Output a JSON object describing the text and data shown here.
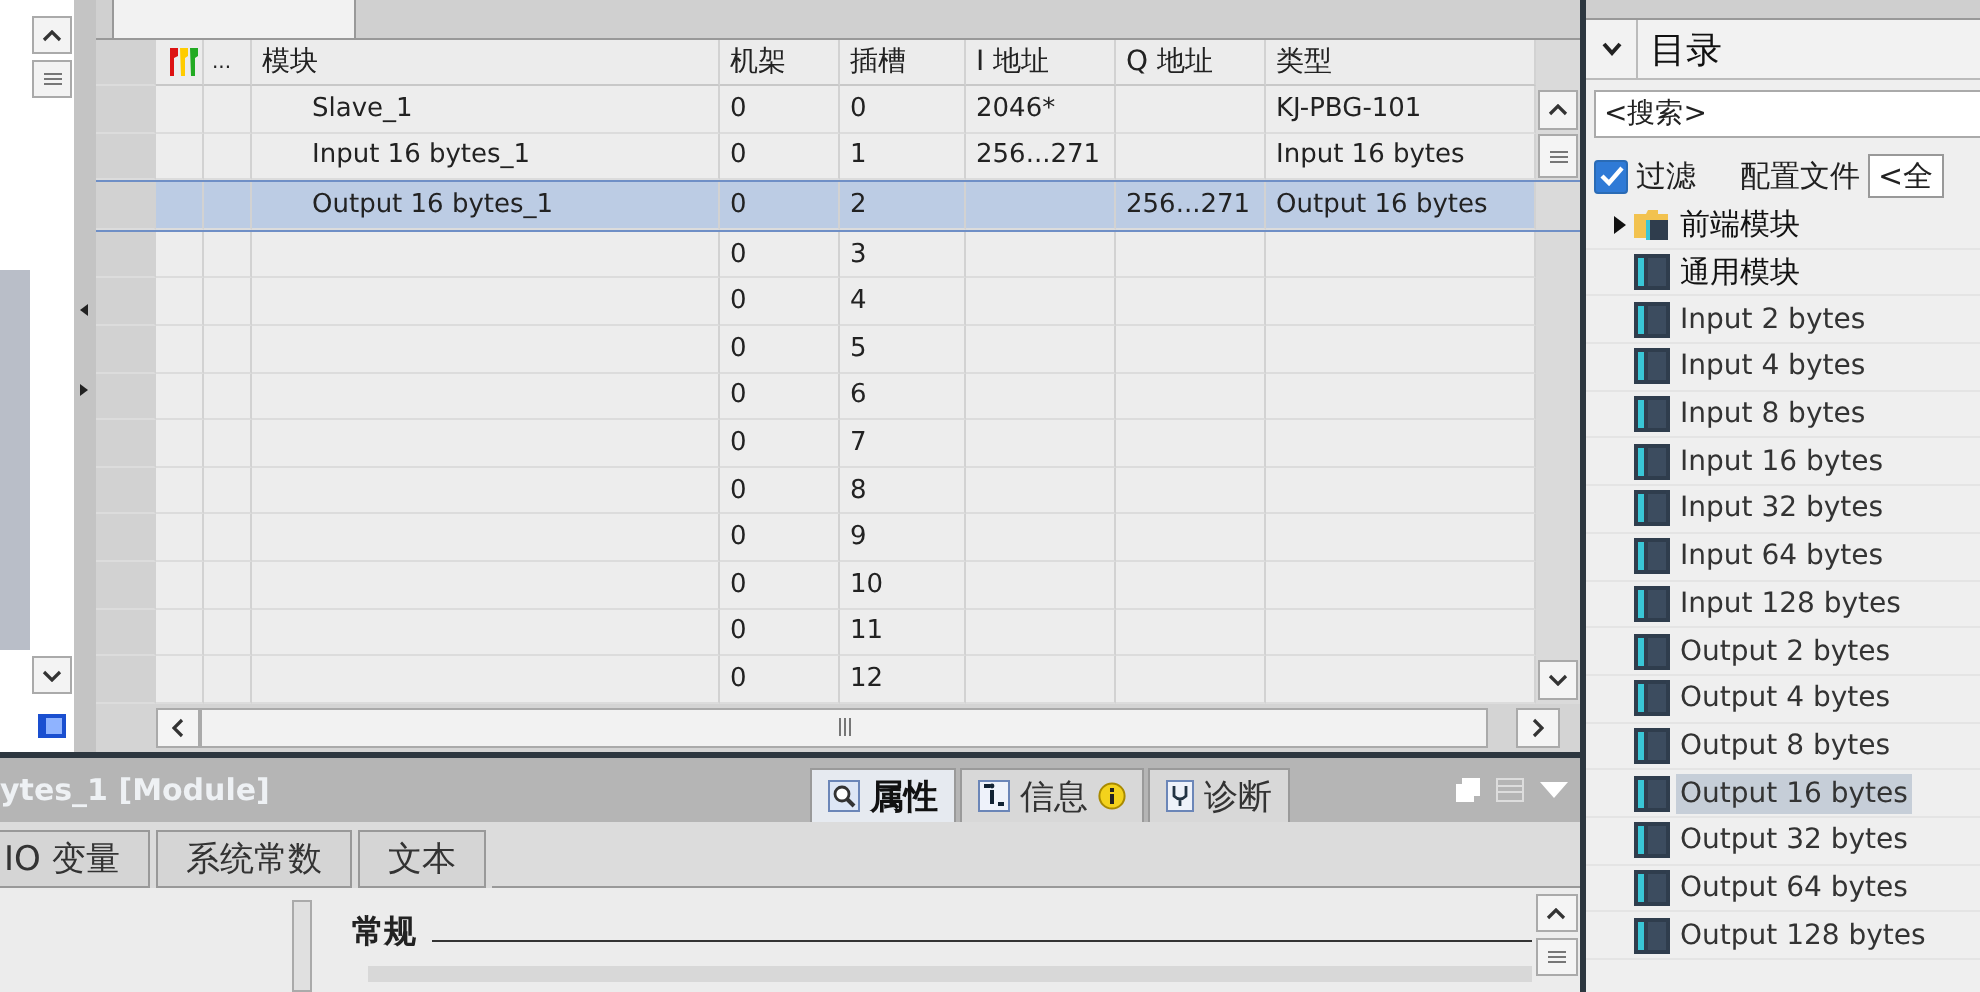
{
  "table": {
    "columns": [
      "...",
      "模块",
      "机架",
      "插槽",
      "I 地址",
      "Q 地址",
      "类型"
    ],
    "rows": [
      {
        "module": "Slave_1",
        "rack": "0",
        "slot": "0",
        "i_address": "2046*",
        "q_address": "",
        "type": "KJ-PBG-101",
        "selected": false
      },
      {
        "module": "Input 16 bytes_1",
        "rack": "0",
        "slot": "1",
        "i_address": "256...271",
        "q_address": "",
        "type": "Input 16 bytes",
        "selected": false
      },
      {
        "module": "Output 16 bytes_1",
        "rack": "0",
        "slot": "2",
        "i_address": "",
        "q_address": "256...271",
        "type": "Output 16 bytes",
        "selected": true
      },
      {
        "module": "",
        "rack": "0",
        "slot": "3",
        "i_address": "",
        "q_address": "",
        "type": "",
        "selected": false
      },
      {
        "module": "",
        "rack": "0",
        "slot": "4",
        "i_address": "",
        "q_address": "",
        "type": "",
        "selected": false
      },
      {
        "module": "",
        "rack": "0",
        "slot": "5",
        "i_address": "",
        "q_address": "",
        "type": "",
        "selected": false
      },
      {
        "module": "",
        "rack": "0",
        "slot": "6",
        "i_address": "",
        "q_address": "",
        "type": "",
        "selected": false
      },
      {
        "module": "",
        "rack": "0",
        "slot": "7",
        "i_address": "",
        "q_address": "",
        "type": "",
        "selected": false
      },
      {
        "module": "",
        "rack": "0",
        "slot": "8",
        "i_address": "",
        "q_address": "",
        "type": "",
        "selected": false
      },
      {
        "module": "",
        "rack": "0",
        "slot": "9",
        "i_address": "",
        "q_address": "",
        "type": "",
        "selected": false
      },
      {
        "module": "",
        "rack": "0",
        "slot": "10",
        "i_address": "",
        "q_address": "",
        "type": "",
        "selected": false
      },
      {
        "module": "",
        "rack": "0",
        "slot": "11",
        "i_address": "",
        "q_address": "",
        "type": "",
        "selected": false
      },
      {
        "module": "",
        "rack": "0",
        "slot": "12",
        "i_address": "",
        "q_address": "",
        "type": "",
        "selected": false
      }
    ]
  },
  "inspector": {
    "title": "ytes_1 [Module]",
    "view_tabs": [
      {
        "label": "属性",
        "kind": "properties",
        "selected": true
      },
      {
        "label": "信息",
        "kind": "info",
        "selected": false
      },
      {
        "label": "诊断",
        "kind": "diagnostics",
        "selected": false
      }
    ],
    "tabs": [
      {
        "label": "IO 变量",
        "selected": false
      },
      {
        "label": "系统常数",
        "selected": false
      },
      {
        "label": "文本",
        "selected": false
      }
    ],
    "section": "常规"
  },
  "catalog": {
    "title": "目录",
    "search": {
      "placeholder": "<搜索>"
    },
    "filter": {
      "label": "过滤",
      "checked": true
    },
    "profile_label": "配置文件",
    "profile_value": "<全",
    "items": [
      {
        "label": "前端模块",
        "kind": "folder",
        "expanded": false,
        "selected": false
      },
      {
        "label": "通用模块",
        "kind": "module",
        "selected": false
      },
      {
        "label": "Input 2 bytes",
        "kind": "module",
        "selected": false
      },
      {
        "label": "Input 4 bytes",
        "kind": "module",
        "selected": false
      },
      {
        "label": "Input 8 bytes",
        "kind": "module",
        "selected": false
      },
      {
        "label": "Input 16 bytes",
        "kind": "module",
        "selected": false
      },
      {
        "label": "Input 32 bytes",
        "kind": "module",
        "selected": false
      },
      {
        "label": "Input 64 bytes",
        "kind": "module",
        "selected": false
      },
      {
        "label": "Input 128 bytes",
        "kind": "module",
        "selected": false
      },
      {
        "label": "Output 2 bytes",
        "kind": "module",
        "selected": false
      },
      {
        "label": "Output 4 bytes",
        "kind": "module",
        "selected": false
      },
      {
        "label": "Output 8 bytes",
        "kind": "module",
        "selected": false
      },
      {
        "label": "Output 16 bytes",
        "kind": "module",
        "selected": true
      },
      {
        "label": "Output 32 bytes",
        "kind": "module",
        "selected": false
      },
      {
        "label": "Output 64 bytes",
        "kind": "module",
        "selected": false
      },
      {
        "label": "Output 128 bytes",
        "kind": "module",
        "selected": false
      }
    ]
  }
}
